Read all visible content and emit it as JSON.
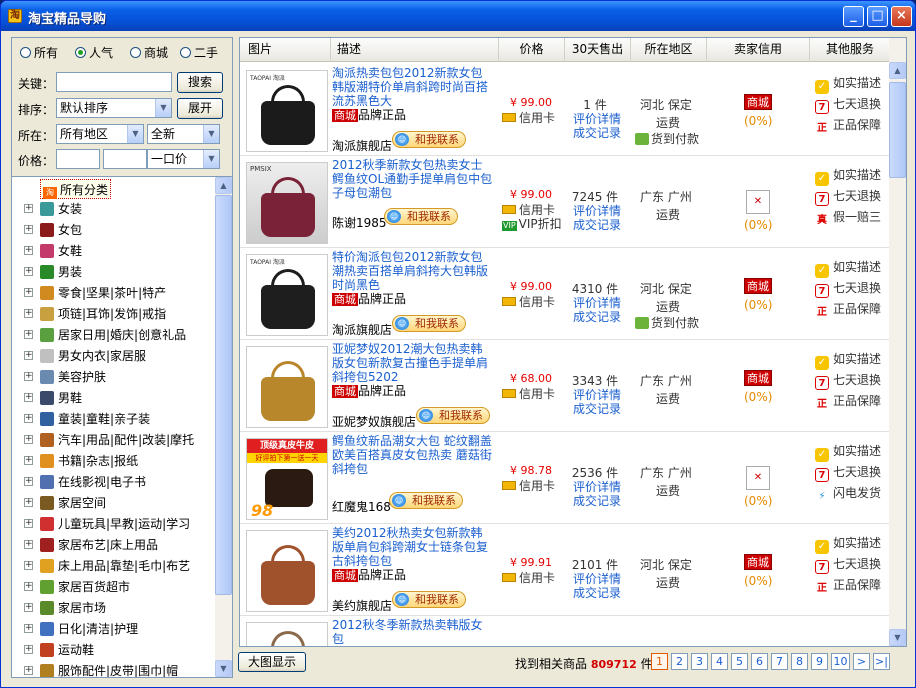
{
  "window": {
    "title": "淘宝精品导购"
  },
  "filters": {
    "sort_options": [
      {
        "label": "所有",
        "selected": false
      },
      {
        "label": "人气",
        "selected": true
      },
      {
        "label": "商城",
        "selected": false
      },
      {
        "label": "二手",
        "selected": false
      }
    ],
    "keyword_label": "关键：",
    "keyword_value": "",
    "search_label": "搜索",
    "order_label": "排序：",
    "order_value": "默认排序",
    "expand_label": "展开",
    "location_label": "所在：",
    "location_value": "所有地区",
    "condition_value": "全新",
    "price_label": "价格：",
    "price_min": "",
    "price_max": "",
    "price_type": "一口价"
  },
  "tree": {
    "root": "所有分类",
    "items": [
      "女装",
      "女包",
      "女鞋",
      "男装",
      "零食|坚果|茶叶|特产",
      "项链|耳饰|发饰|戒指",
      "居家日用|婚庆|创意礼品",
      "男女内衣|家居服",
      "美容护肤",
      "男鞋",
      "童装|童鞋|亲子装",
      "汽车|用品|配件|改装|摩托",
      "书籍|杂志|报纸",
      "在线影视|电子书",
      "家居空间",
      "儿童玩具|早教|运动|学习",
      "家居布艺|床上用品",
      "床上用品|靠垫|毛巾|布艺",
      "家居百货超市",
      "家居市场",
      "日化|清洁|护理",
      "运动鞋",
      "服饰配件|皮带|围巾|帽"
    ]
  },
  "grid": {
    "headers": [
      "图片",
      "描述",
      "价格",
      "30天售出",
      "所在地区",
      "卖家信用",
      "其他服务"
    ],
    "rows": [
      {
        "name": "淘派热卖包包2012新款女包韩版潮特价单肩斜跨时尚百搭流苏黑色大",
        "tmall": "商城",
        "tmall_suffix": "品牌正品",
        "shop": "淘派旗舰店",
        "chat": "和我联系",
        "price": "¥ 99.00",
        "pay": "信用卡",
        "vip": "",
        "sold": "1 件",
        "review": "评价详情",
        "records": "成交记录",
        "loc": "河北  保定",
        "fee": "运费",
        "cod": "货到付款",
        "credit": "商城",
        "credit_pct": "(0%)",
        "services": [
          "如实描述",
          "七天退换",
          "正品保障"
        ]
      },
      {
        "name": "2012秋季新款女包热卖女士鳄鱼纹OL通勤手提单肩包中包子母包潮包",
        "tmall": "",
        "tmall_suffix": "",
        "shop": "陈谢1985",
        "chat": "和我联系",
        "price": "¥ 99.00",
        "pay": "信用卡",
        "vip": "VIP折扣",
        "sold": "7245 件",
        "review": "评价详情",
        "records": "成交记录",
        "loc": "广东  广州",
        "fee": "运费",
        "cod": "",
        "credit": "",
        "credit_pct": "(0%)",
        "services": [
          "如实描述",
          "七天退换",
          "假一赔三"
        ]
      },
      {
        "name": "特价淘派包包2012新款女包潮热卖百搭单肩斜挎大包韩版时尚黑色",
        "tmall": "商城",
        "tmall_suffix": "品牌正品",
        "shop": "淘派旗舰店",
        "chat": "和我联系",
        "price": "¥ 99.00",
        "pay": "信用卡",
        "vip": "",
        "sold": "4310 件",
        "review": "评价详情",
        "records": "成交记录",
        "loc": "河北  保定",
        "fee": "运费",
        "cod": "货到付款",
        "credit": "商城",
        "credit_pct": "(0%)",
        "services": [
          "如实描述",
          "七天退换",
          "正品保障"
        ]
      },
      {
        "name": "亚妮梦奴2012潮大包热卖韩版女包新款复古撞色手提单肩斜挎包5202",
        "tmall": "商城",
        "tmall_suffix": "品牌正品",
        "shop": "亚妮梦奴旗舰店",
        "chat": "和我联系",
        "price": "¥ 68.00",
        "pay": "信用卡",
        "vip": "",
        "sold": "3343 件",
        "review": "评价详情",
        "records": "成交记录",
        "loc": "广东  广州",
        "fee": "运费",
        "cod": "",
        "credit": "商城",
        "credit_pct": "(0%)",
        "services": [
          "如实描述",
          "七天退换",
          "正品保障"
        ]
      },
      {
        "name": "鳄鱼纹新品潮女大包  蛇纹翻盖欧美百搭真皮女包热卖  蘑菇街斜挎包",
        "tmall": "",
        "tmall_suffix": "",
        "shop": "红魔鬼168",
        "chat": "和我联系",
        "price": "¥ 98.78",
        "pay": "信用卡",
        "vip": "",
        "sold": "2536 件",
        "review": "评价详情",
        "records": "成交记录",
        "loc": "广东  广州",
        "fee": "运费",
        "cod": "",
        "credit": "",
        "credit_pct": "(0%)",
        "services": [
          "如实描述",
          "七天退换",
          "闪电发货"
        ]
      },
      {
        "name": "美约2012秋热卖女包新款韩版单肩包斜跨潮女士链条包复古斜挎包包",
        "tmall": "商城",
        "tmall_suffix": "品牌正品",
        "shop": "美约旗舰店",
        "chat": "和我联系",
        "price": "¥ 99.91",
        "pay": "信用卡",
        "vip": "",
        "sold": "2101 件",
        "review": "评价详情",
        "records": "成交记录",
        "loc": "河北  保定",
        "fee": "运费",
        "cod": "",
        "credit": "商城",
        "credit_pct": "(0%)",
        "services": [
          "如实描述",
          "七天退换",
          "正品保障"
        ]
      },
      {
        "name": "2012秋冬季新款热卖韩版女包",
        "tmall": "",
        "tmall_suffix": "",
        "shop": "",
        "chat": "",
        "price": "",
        "pay": "",
        "vip": "",
        "sold": "",
        "review": "",
        "records": "",
        "loc": "",
        "fee": "",
        "cod": "",
        "credit": "",
        "credit_pct": "",
        "services": []
      }
    ]
  },
  "thumb_text": {
    "r0": "TAOPAI 淘派",
    "r1": "PMSIX",
    "r2": "TAOPAI 淘派",
    "r4_top": "顶级真皮牛皮",
    "r4_sub": "好评拍下第一送一天",
    "r4_price": "98"
  },
  "footer": {
    "big_view": "大图显示",
    "found_prefix": "找到相关商品",
    "found_count": "809712",
    "found_suffix": "件",
    "pages": [
      "1",
      "2",
      "3",
      "4",
      "5",
      "6",
      "7",
      "8",
      "9",
      "10",
      ">",
      ">|"
    ],
    "current_page": "1"
  },
  "colors": {
    "accent": "#1a5fcf",
    "price": "#e60000",
    "tmall": "#cc0000",
    "titlebar": "#0a5fe6"
  }
}
